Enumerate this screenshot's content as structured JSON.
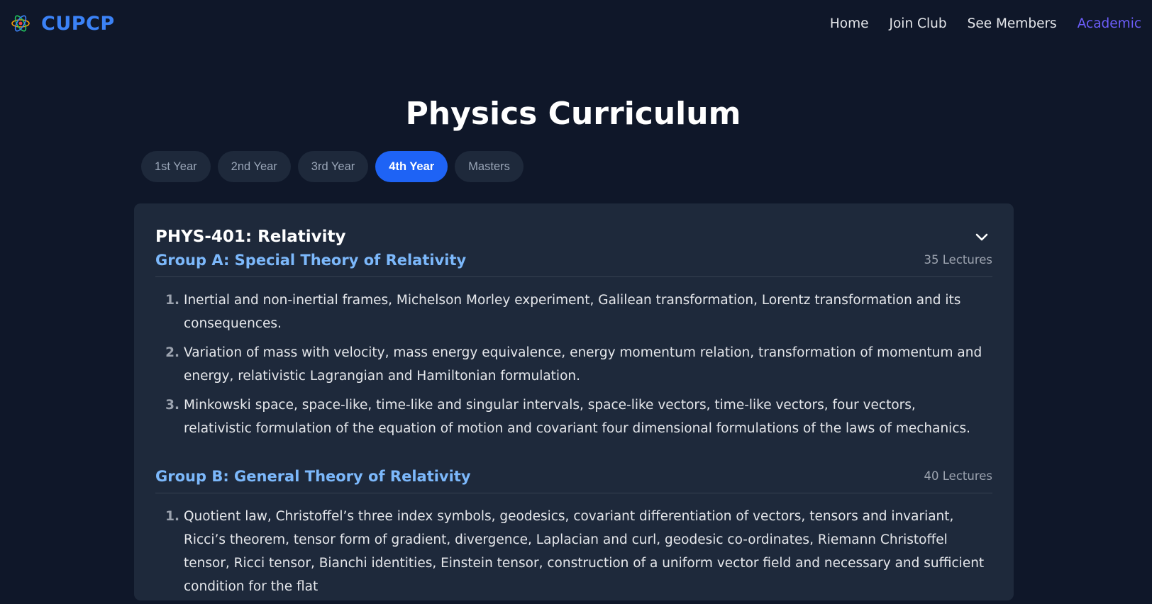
{
  "brand": {
    "name": "CUPCP",
    "logo_icon": "atom-icon"
  },
  "nav": {
    "items": [
      {
        "label": "Home",
        "active": false
      },
      {
        "label": "Join Club",
        "active": false
      },
      {
        "label": "See Members",
        "active": false
      },
      {
        "label": "Academic",
        "active": true
      }
    ]
  },
  "page": {
    "title": "Physics Curriculum"
  },
  "tabs": [
    {
      "label": "1st Year",
      "active": false
    },
    {
      "label": "2nd Year",
      "active": false
    },
    {
      "label": "3rd Year",
      "active": false
    },
    {
      "label": "4th Year",
      "active": true
    },
    {
      "label": "Masters",
      "active": false
    }
  ],
  "course": {
    "title": "PHYS-401: Relativity",
    "toggle_icon": "chevron-down-icon",
    "groups": [
      {
        "title": "Group A: Special Theory of Relativity",
        "lectures": "35 Lectures",
        "items": [
          {
            "num": "1.",
            "text": "Inertial and non-inertial frames, Michelson Morley experiment, Galilean transformation, Lorentz transformation and its consequences."
          },
          {
            "num": "2.",
            "text": "Variation of mass with velocity, mass energy equivalence, energy momentum relation, transformation of momentum and energy, relativistic Lagrangian and Hamiltonian formulation."
          },
          {
            "num": "3.",
            "text": "Minkowski space, space-like, time-like and singular intervals, space-like vectors, time-like vectors, four vectors, relativistic formulation of the equation of motion and covariant four dimensional formulations of the laws of mechanics."
          }
        ]
      },
      {
        "title": "Group B: General Theory of Relativity",
        "lectures": "40 Lectures",
        "items": [
          {
            "num": "1.",
            "text": "Quotient law, Christoffel’s three index symbols, geodesics, covariant differentiation of vectors, tensors and invariant, Ricci’s theorem, tensor form of gradient, divergence, Laplacian and curl, geodesic co-ordinates, Riemann Christoffel tensor, Ricci tensor, Bianchi identities, Einstein tensor, construction of a uniform vector field and necessary and sufficient condition for the flat"
          }
        ]
      }
    ]
  },
  "colors": {
    "background": "#0f1729",
    "card": "#1e293b",
    "brand": "#3b82f6",
    "active_tab": "#1e63f5",
    "active_nav": "#6d5efc",
    "group_title": "#7cb8fb"
  }
}
